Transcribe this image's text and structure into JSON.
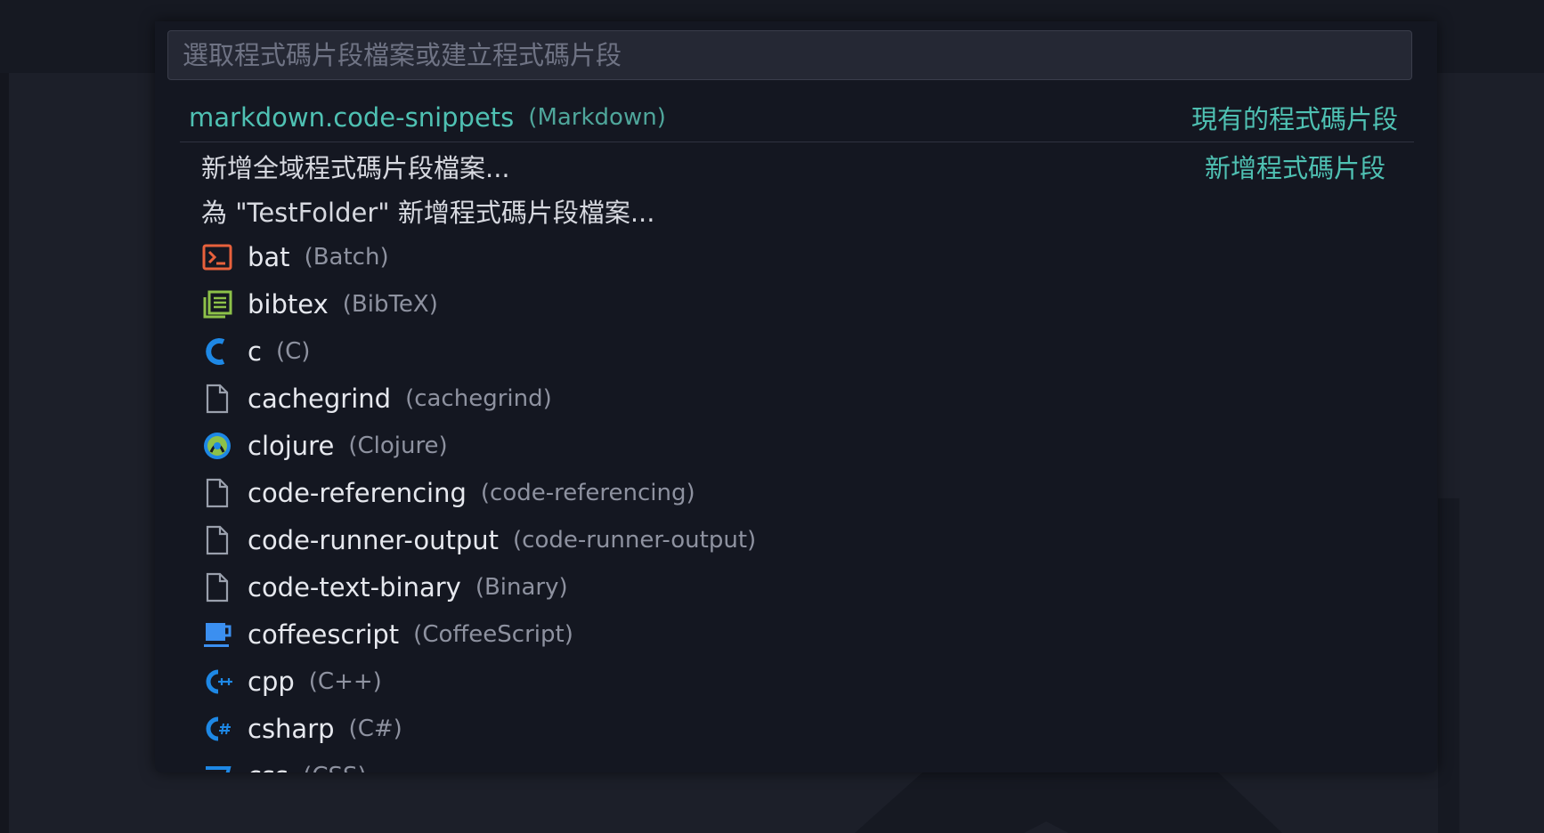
{
  "quick_pick": {
    "placeholder": "選取程式碼片段檔案或建立程式碼片段"
  },
  "existing": {
    "name": "markdown.code-snippets",
    "description": "(Markdown)",
    "separator_label": "現有的程式碼片段"
  },
  "actions": [
    {
      "label": "新增全域程式碼片段檔案...",
      "separator_label": "新增程式碼片段"
    },
    {
      "label": "為 \"TestFolder\" 新增程式碼片段檔案...",
      "separator_label": ""
    }
  ],
  "languages": [
    {
      "name": "bat",
      "desc": "(Batch)",
      "icon": "terminal-icon",
      "color": "#e8613c"
    },
    {
      "name": "bibtex",
      "desc": "(BibTeX)",
      "icon": "document-list-icon",
      "color": "#8dc149"
    },
    {
      "name": "c",
      "desc": "(C)",
      "icon": "c-lang-icon",
      "color": "#1e88e5"
    },
    {
      "name": "cachegrind",
      "desc": "(cachegrind)",
      "icon": "file-icon",
      "color": "#9aa0ad"
    },
    {
      "name": "clojure",
      "desc": "(Clojure)",
      "icon": "clojure-icon",
      "color": "#8dc149"
    },
    {
      "name": "code-referencing",
      "desc": "(code-referencing)",
      "icon": "file-icon",
      "color": "#9aa0ad"
    },
    {
      "name": "code-runner-output",
      "desc": "(code-runner-output)",
      "icon": "file-icon",
      "color": "#9aa0ad"
    },
    {
      "name": "code-text-binary",
      "desc": "(Binary)",
      "icon": "file-icon",
      "color": "#9aa0ad"
    },
    {
      "name": "coffeescript",
      "desc": "(CoffeeScript)",
      "icon": "coffee-icon",
      "color": "#3b8ff0"
    },
    {
      "name": "cpp",
      "desc": "(C++)",
      "icon": "cpp-icon",
      "color": "#1e88e5"
    },
    {
      "name": "csharp",
      "desc": "(C#)",
      "icon": "csharp-icon",
      "color": "#1e88e5"
    },
    {
      "name": "css",
      "desc": "(CSS)",
      "icon": "css-icon",
      "color": "#1e88e5"
    }
  ]
}
